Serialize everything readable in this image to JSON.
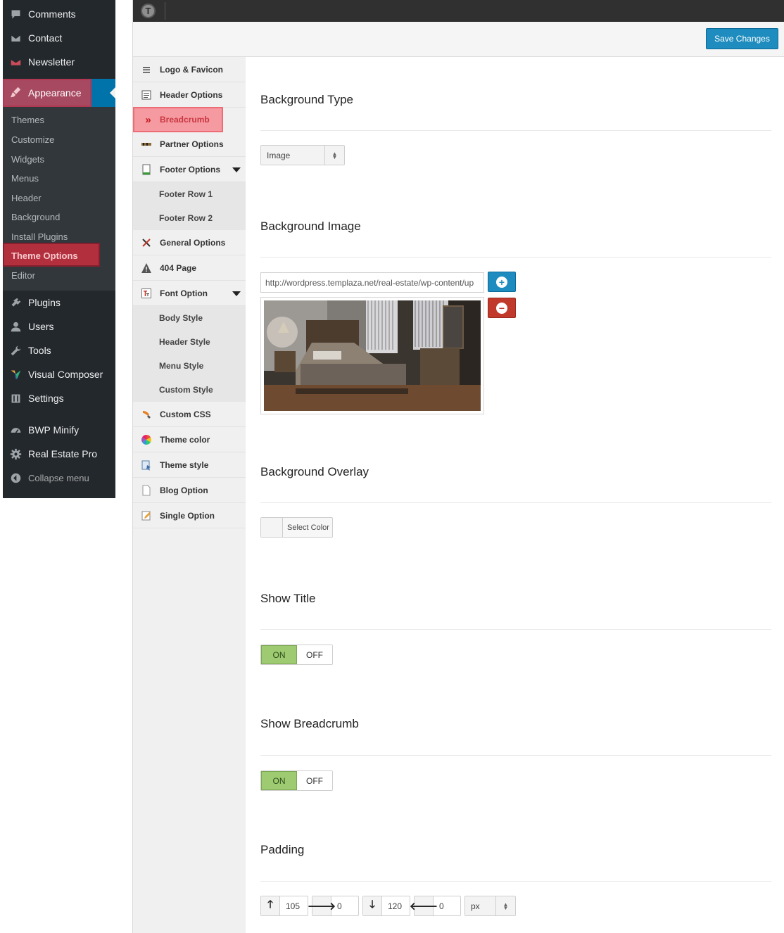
{
  "wp_menu": {
    "comments": "Comments",
    "contact": "Contact",
    "newsletter": "Newsletter",
    "appearance": "Appearance",
    "submenu": [
      "Themes",
      "Customize",
      "Widgets",
      "Menus",
      "Header",
      "Background",
      "Install Plugins",
      "Theme Options",
      "Editor"
    ],
    "plugins": "Plugins",
    "users": "Users",
    "tools": "Tools",
    "visual_composer": "Visual Composer",
    "settings": "Settings",
    "bwp_minify": "BWP Minify",
    "real_estate_pro": "Real Estate Pro",
    "collapse": "Collapse menu"
  },
  "toolbar": {
    "save_label": "Save Changes"
  },
  "options_menu": {
    "logo_favicon": "Logo & Favicon",
    "header_options": "Header Options",
    "breadcrumb": "Breadcrumb",
    "partner_options": "Partner Options",
    "footer_options": "Footer Options",
    "footer_row_1": "Footer Row 1",
    "footer_row_2": "Footer Row 2",
    "general_options": "General Options",
    "page_404": "404 Page",
    "font_option": "Font Option",
    "body_style": "Body Style",
    "header_style": "Header Style",
    "menu_style": "Menu Style",
    "custom_style": "Custom Style",
    "custom_css": "Custom CSS",
    "theme_color": "Theme color",
    "theme_style": "Theme style",
    "blog_option": "Blog Option",
    "single_option": "Single Option"
  },
  "content": {
    "bg_type_title": "Background Type",
    "bg_type_value": "Image",
    "bg_image_title": "Background Image",
    "bg_image_url": "http://wordpress.templaza.net/real-estate/wp-content/up",
    "bg_overlay_title": "Background Overlay",
    "select_color": "Select Color",
    "show_title_title": "Show Title",
    "show_breadcrumb_title": "Show Breadcrumb",
    "on_label": "ON",
    "off_label": "OFF",
    "padding_title": "Padding",
    "padding_top": "105",
    "padding_right": "0",
    "padding_bottom": "120",
    "padding_left": "0",
    "padding_unit": "px"
  },
  "colors": {
    "wp_sidebar": "#23282d",
    "wp_accent": "#0073aa",
    "highlight": "#c0303f",
    "toggle_on": "#9ecb72",
    "save_button": "#1e8cbe"
  }
}
